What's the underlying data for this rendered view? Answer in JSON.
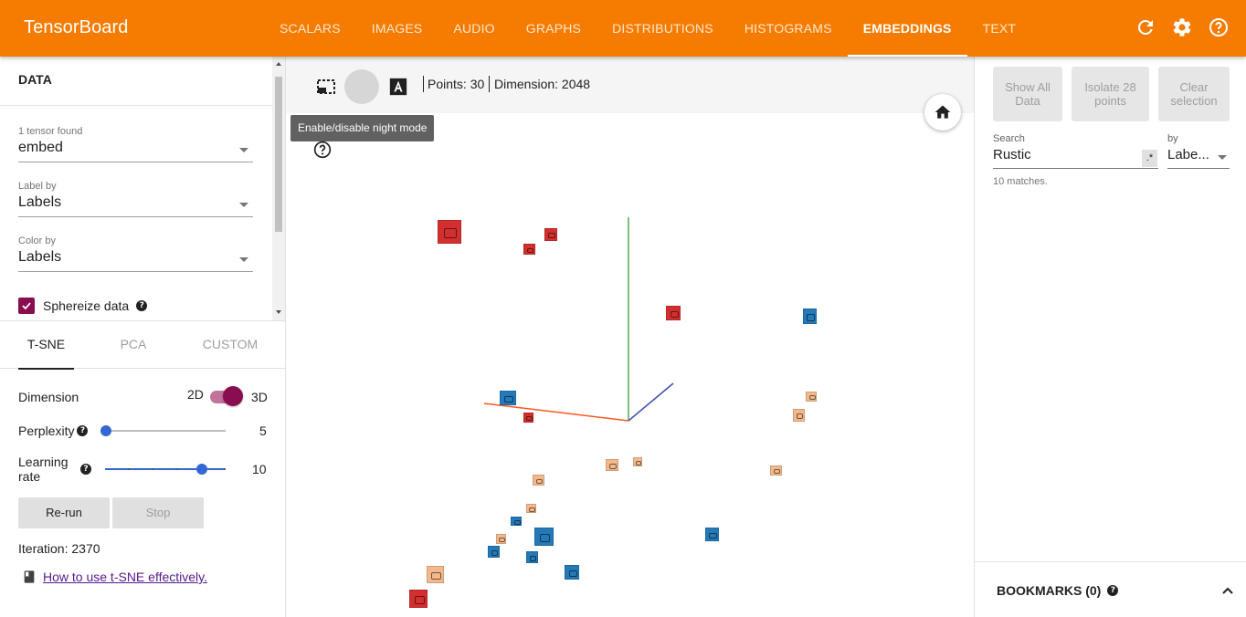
{
  "header": {
    "title": "TensorBoard",
    "tabs": [
      {
        "label": "SCALARS"
      },
      {
        "label": "IMAGES"
      },
      {
        "label": "AUDIO"
      },
      {
        "label": "GRAPHS"
      },
      {
        "label": "DISTRIBUTIONS"
      },
      {
        "label": "HISTOGRAMS"
      },
      {
        "label": "EMBEDDINGS"
      },
      {
        "label": "TEXT"
      }
    ],
    "active_tab": "EMBEDDINGS",
    "icons": [
      "refresh-icon",
      "settings-icon",
      "help-icon"
    ],
    "color": "#f57c00"
  },
  "data_panel": {
    "title": "DATA",
    "tensor_label": "1 tensor found",
    "tensor_value": "embed",
    "label_by_label": "Label by",
    "label_by_value": "Labels",
    "color_by_label": "Color by",
    "color_by_value": "Labels",
    "sphereize_label": "Sphereize data",
    "sphereize_checked": true
  },
  "projection": {
    "tabs": [
      "T-SNE",
      "PCA",
      "CUSTOM"
    ],
    "active_tab": "T-SNE",
    "dimension_label": "Dimension",
    "dim_2d": "2D",
    "dim_3d": "3D",
    "dimension_value": "3D",
    "perplexity_label": "Perplexity",
    "perplexity_value": "5",
    "learning_rate_label": "Learning rate",
    "learning_rate_value": "10",
    "rerun_label": "Re-run",
    "stop_label": "Stop",
    "iteration_text": "Iteration: 2370",
    "tsne_link": "How to use t-SNE effectively."
  },
  "toolbar": {
    "points_text": "Points: 30",
    "dimension_text": "Dimension: 2048",
    "tooltip": "Enable/disable night mode",
    "night_mode_active": true
  },
  "right_panel": {
    "show_all": "Show All Data",
    "isolate": "Isolate 28 points",
    "clear": "Clear selection",
    "search_label": "Search",
    "search_value": "Rustic",
    "regex_label": ".*",
    "by_label": "by",
    "by_value": "Labe...",
    "matches": "10 matches.",
    "bookmarks": "BOOKMARKS (0)"
  },
  "scatter": {
    "label_colors": {
      "red": "#d32f2f",
      "blue": "#2479b8",
      "tan": "#f4b98b"
    },
    "axis_colors": {
      "x": "#ff5722",
      "y": "#4caf50",
      "z": "#3f51b5"
    }
  }
}
